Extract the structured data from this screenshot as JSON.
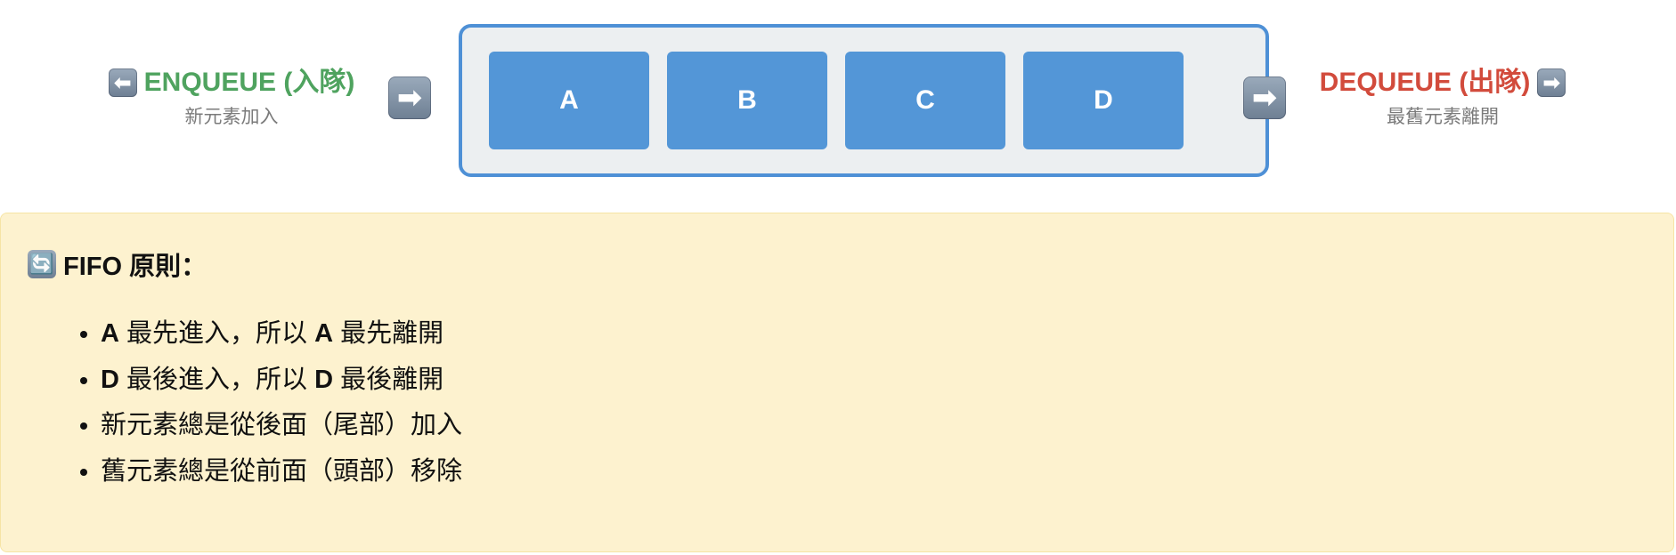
{
  "enqueue": {
    "icon": "left-arrow-icon",
    "label": "ENQUEUE (入隊)",
    "subtitle": "新元素加入",
    "color": "#4fa35f"
  },
  "dequeue": {
    "icon": "right-arrow-icon",
    "label": "DEQUEUE (出隊)",
    "subtitle": "最舊元素離開",
    "color": "#d24b3c"
  },
  "flow_arrows": {
    "icon": "right-arrow-icon"
  },
  "queue": {
    "border_color": "#4e90d6",
    "item_color": "#5396d7",
    "items": [
      "A",
      "B",
      "C",
      "D"
    ]
  },
  "fifo": {
    "icon": "cycle-arrows-icon",
    "title": "FIFO 原則：",
    "points": [
      {
        "bold1": "A",
        "text1": " 最先進入，所以 ",
        "bold2": "A",
        "text2": " 最先離開"
      },
      {
        "bold1": "D",
        "text1": " 最後進入，所以 ",
        "bold2": "D",
        "text2": " 最後離開"
      },
      {
        "bold1": "",
        "text1": "新元素總是從後面（尾部）加入",
        "bold2": "",
        "text2": ""
      },
      {
        "bold1": "",
        "text1": "舊元素總是從前面（頭部）移除",
        "bold2": "",
        "text2": ""
      }
    ]
  }
}
